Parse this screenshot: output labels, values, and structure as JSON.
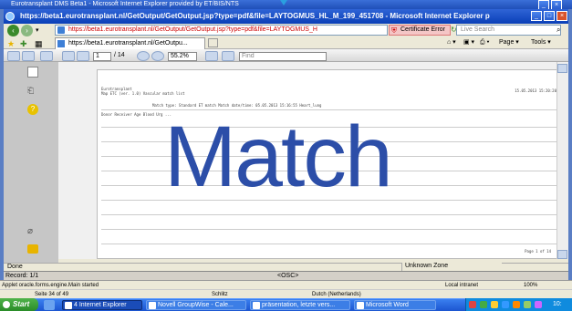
{
  "outer_window": {
    "title": "Eurotransplant DMS Beta1 - Microsoft Internet Explorer provided by ET/BIS/NTS"
  },
  "ie_window": {
    "title": "https://beta1.eurotransplant.nl/GetOutput/GetOutput.jsp?type=pdf&file=LAYTOGMUS_HL_M_199_451708 - Microsoft Internet Explorer p"
  },
  "address_bar": {
    "url": "https://beta1.eurotransplant.nl/GetOutput/GetOutput.jsp?type=pdf&file=LAYTOGMUS_H",
    "certificate": "Certificate Error",
    "search_placeholder": "Live Search"
  },
  "tabs": {
    "active_tab": "https://beta1.eurotransplant.nl/GetOutpu...",
    "page_menu": "Page",
    "tools_menu": "Tools"
  },
  "pdf_toolbar": {
    "current_page": "1",
    "total_pages": "/ 14",
    "zoom": "55.2%",
    "find_placeholder": "Find"
  },
  "report": {
    "header_lines": [
      "Eurotransplant",
      "Map ETC (ver. 1.0) Vascular match list",
      "Match type: Standard ET match        Match date/time: 05.05.2013 15:16:55        Heart_lung",
      "Donor  Receiver  Age  Blood  Urg  ..."
    ],
    "date": "15.05.2013 15:20:20",
    "page_label": "Page   1  of  14"
  },
  "watermark": "Match",
  "status": {
    "done": "Done",
    "zone": "Unknown Zone",
    "record": "Record: 1/1",
    "osc": "<OSC>",
    "applet": "Applet oracle.forms.engine.Main started",
    "local_intranet": "Local intranet",
    "zoom_status": "100%"
  },
  "word_status": {
    "page": "Seite 34 of 49",
    "mode": "Schlitz",
    "language": "Dutch (Netherlands)"
  },
  "taskbar": {
    "start": "Start",
    "tasks": [
      "4 Internet Explorer",
      "Novell GroupWise - Cale...",
      "präsentation, letzte vers...",
      "Microsoft Word"
    ],
    "clock": "10:"
  },
  "colors": {
    "watermark": "#2c4ea8",
    "title_bar": "#0a3fb7",
    "taskbar": "#1c55d0",
    "start": "#2a8c28"
  }
}
